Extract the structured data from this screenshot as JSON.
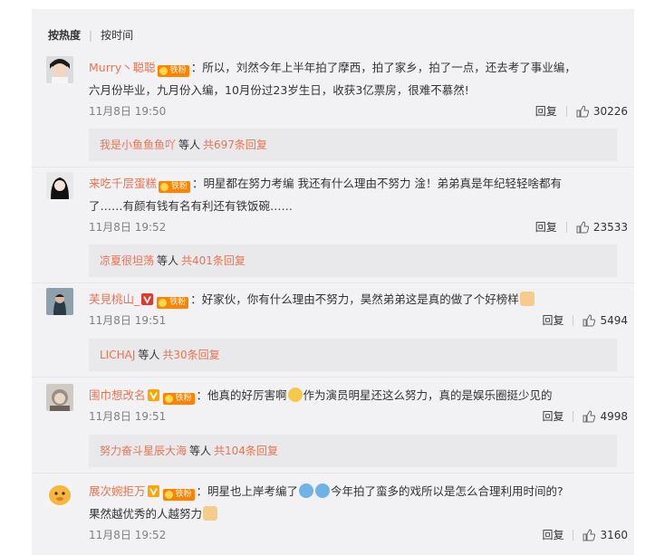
{
  "sort": {
    "by_heat": "按热度",
    "by_time": "按时间"
  },
  "comments": [
    {
      "user": "Murry丶聪聪",
      "fan_label": "铁粉",
      "text1": "：所以，刘然今年上半年拍了摩西，拍了家乡，拍了一点，还去考了事业编，",
      "text2": "六月份毕业，九月份入编，10月份过23岁生日，收获3亿票房，很难不慕然!",
      "time": "11月8日 19:50",
      "reply_label": "回复",
      "likes": "30226",
      "replies": {
        "who": "我是小鱼鱼鱼吖",
        "mid": "等人",
        "count": "共697条回复"
      }
    },
    {
      "user": "来吃千层蛋糕",
      "fan_label": "铁粉",
      "text1": "：明星都在努力考编 我还有什么理由不努力 淦！弟弟真是年纪轻轻啥都有",
      "text2": "了……有颜有钱有名有利还有铁饭碗……",
      "time": "11月8日 19:52",
      "reply_label": "回复",
      "likes": "23533",
      "replies": {
        "who": "凉夏很坦荡",
        "mid": "等人",
        "count": "共401条回复"
      }
    },
    {
      "user": "芙見桃山_",
      "fan_label": "铁粉",
      "text1": "：好家伙，你有什么理由不努力，昊然弟弟这是真的做了个好榜样",
      "time": "11月8日 19:51",
      "reply_label": "回复",
      "likes": "5494",
      "replies": {
        "who": "LICHAJ",
        "mid": "等人",
        "count": "共30条回复"
      }
    },
    {
      "user": "围巾想改名",
      "fan_label": "铁粉",
      "text1": "：他真的好厉害啊",
      "text1b": "作为演员明星还这么努力，真的是娱乐圈挺少见的",
      "time": "11月8日 19:51",
      "reply_label": "回复",
      "likes": "4998",
      "replies": {
        "who": "努力奋斗星辰大海",
        "mid": "等人",
        "count": "共104条回复"
      }
    },
    {
      "user": "展次婉拒万",
      "fan_label": "铁粉",
      "text1": "：明星也上岸考编了",
      "text1b": "今年拍了蛮多的戏所以是怎么合理利用时间的?",
      "text2": "果然越优秀的人越努力",
      "time": "11月8日 19:52",
      "reply_label": "回复",
      "likes": "3160"
    }
  ]
}
